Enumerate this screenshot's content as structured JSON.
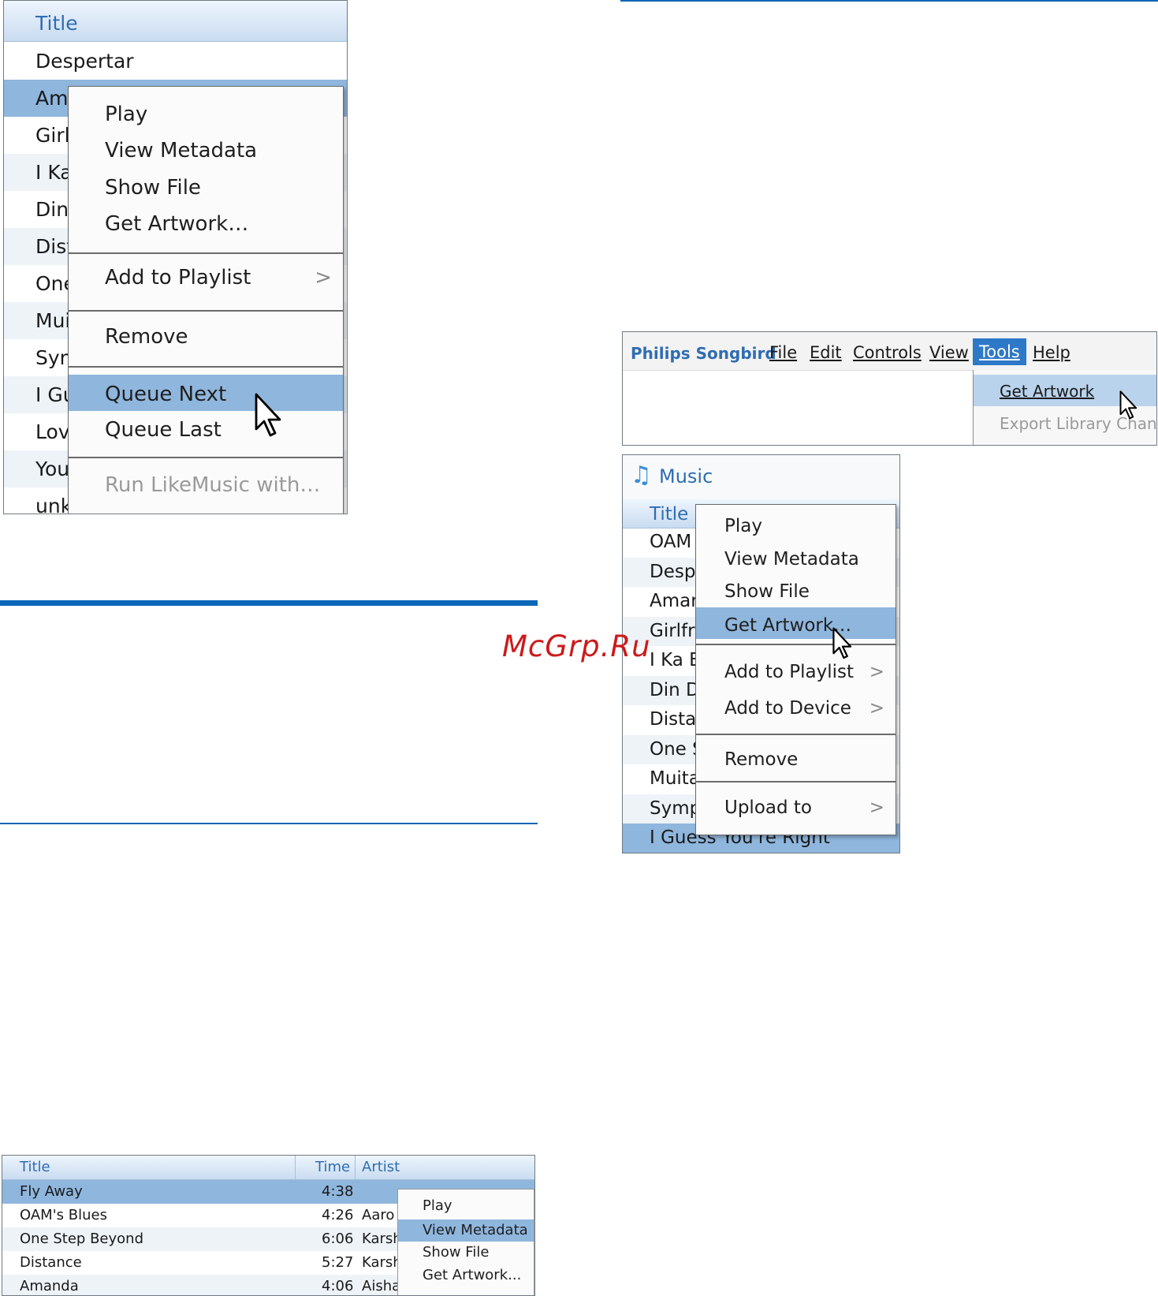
{
  "watermark": "McGrp.Ru",
  "colors": {
    "accent_blue": "#0a66b7",
    "menu_highlight": "#8fb6dd",
    "header_text": "#2f6db3"
  },
  "shot_queue": {
    "header": "Title",
    "rows": [
      "Despertar",
      "Am",
      "Girl",
      "I Ka",
      "Din",
      "Dist",
      "One",
      "Mui",
      "Syn",
      "I Gu",
      "Lov",
      "You",
      "unk"
    ],
    "menu": {
      "play": "Play",
      "view_metadata": "View Metadata",
      "show_file": "Show File",
      "get_artwork": "Get Artwork…",
      "add_to_playlist": "Add to Playlist",
      "remove": "Remove",
      "queue_next": "Queue Next",
      "queue_last": "Queue Last",
      "run_likemusic": "Run LikeMusic with…",
      "submenu_chevron": ">"
    }
  },
  "shot_toolbar": {
    "app_name": "Philips Songbird",
    "menus": [
      "File",
      "Edit",
      "Controls",
      "View",
      "Tools",
      "Help"
    ],
    "dropdown": {
      "get_artwork": "Get Artwork",
      "export": "Export Library Chang"
    }
  },
  "shot_music": {
    "title": "Music",
    "header": "Title",
    "rows": [
      "OAM",
      "Desp",
      "Amar",
      "Girlfr",
      "I Ka E",
      "Din D",
      "Dista",
      "One S",
      "Muita",
      "Symp",
      "I Guess You're Right"
    ],
    "menu": {
      "play": "Play",
      "view_metadata": "View Metadata",
      "show_file": "Show File",
      "get_artwork": "Get Artwork…",
      "add_to_playlist": "Add to Playlist",
      "add_to_device": "Add to Device",
      "remove": "Remove",
      "upload_to": "Upload to",
      "submenu_chevron": ">"
    }
  },
  "shot_table": {
    "columns": {
      "title": "Title",
      "time": "Time",
      "artist": "Artist"
    },
    "rows": [
      {
        "title": "Fly Away",
        "time": "4:38",
        "artist": ""
      },
      {
        "title": "OAM's Blues",
        "time": "4:26",
        "artist": "Aaro"
      },
      {
        "title": "One Step Beyond",
        "time": "6:06",
        "artist": "Karsh"
      },
      {
        "title": "Distance",
        "time": "5:27",
        "artist": "Karsh"
      },
      {
        "title": "Amanda",
        "time": "4:06",
        "artist": "Aisha"
      }
    ],
    "menu": {
      "play": "Play",
      "view_metadata": "View Metadata",
      "show_file": "Show File",
      "get_artwork": "Get Artwork..."
    }
  }
}
